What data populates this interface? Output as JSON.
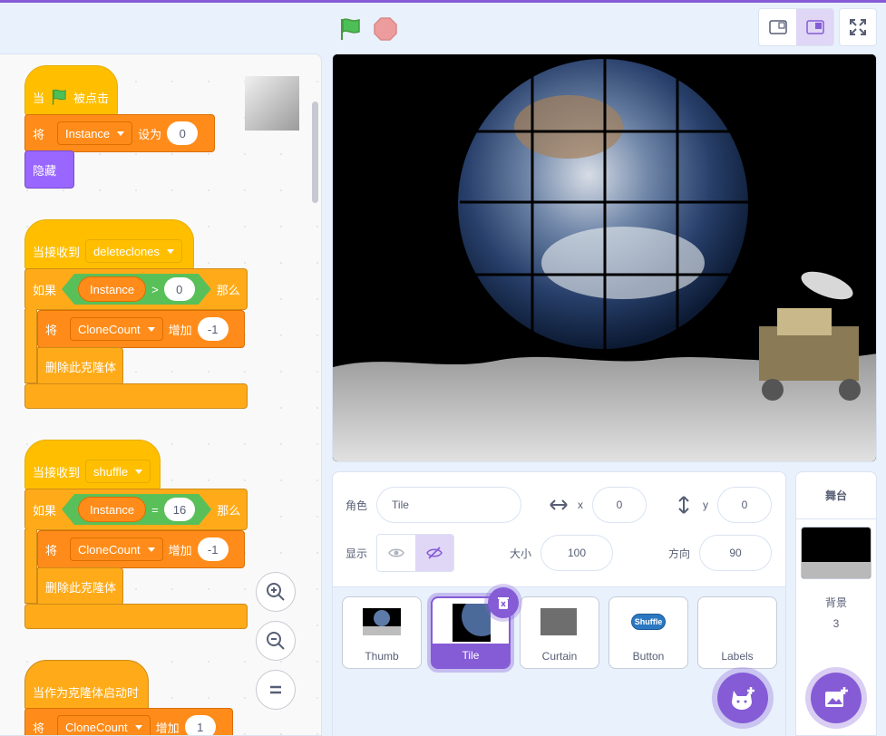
{
  "toolbar": {
    "green_flag": "green-flag",
    "stop": "stop-sign"
  },
  "code": {
    "script1": {
      "when_flag": "当",
      "clicked": "被点击",
      "set_label": "将",
      "var": "Instance",
      "to_label": "设为",
      "value": "0",
      "hide": "隐藏"
    },
    "script2": {
      "receive": "当接收到",
      "message": "deleteclones",
      "if": "如果",
      "var": "Instance",
      "op": ">",
      "value": "0",
      "then": "那么",
      "set_label": "将",
      "clone_var": "CloneCount",
      "add_label": "增加",
      "add_value": "-1",
      "delete": "删除此克隆体"
    },
    "script3": {
      "receive": "当接收到",
      "message": "shuffle",
      "if": "如果",
      "var": "Instance",
      "op": "=",
      "value": "16",
      "then": "那么",
      "set_label": "将",
      "clone_var": "CloneCount",
      "add_label": "增加",
      "add_value": "-1",
      "delete": "删除此克隆体"
    },
    "script4": {
      "start_clone": "当作为克隆体启动时",
      "set_label": "将",
      "clone_var": "CloneCount",
      "add_label": "增加",
      "add_value": "1"
    }
  },
  "sprite_info": {
    "sprite_label": "角色",
    "sprite_name": "Tile",
    "x_label": "x",
    "x_value": "0",
    "y_label": "y",
    "y_value": "0",
    "show_label": "显示",
    "size_label": "大小",
    "size_value": "100",
    "direction_label": "方向",
    "direction_value": "90"
  },
  "sprites": [
    {
      "name": "Thumb"
    },
    {
      "name": "Tile",
      "selected": true
    },
    {
      "name": "Curtain"
    },
    {
      "name": "Button",
      "badge": "Shuffle"
    },
    {
      "name": "Labels"
    }
  ],
  "stage_panel": {
    "title": "舞台",
    "backdrops_label": "背景",
    "backdrops_count": "3"
  },
  "colors": {
    "accent": "#855cd6",
    "events": "#ffbf00",
    "variables": "#ff8c1a",
    "control": "#ffab19",
    "operators": "#59c059",
    "looks": "#9966ff"
  }
}
